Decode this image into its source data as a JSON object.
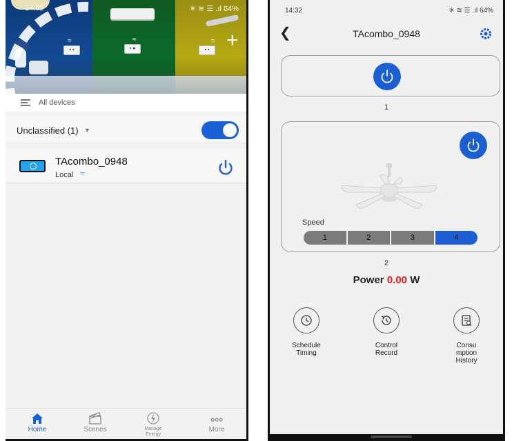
{
  "left_screen": {
    "status_bar": {
      "time": "14:32",
      "icons": "✳ ≋ ☰ .ıl",
      "battery": "64%"
    },
    "filter": {
      "label": "All devices"
    },
    "group": {
      "label": "Unclassified (1)",
      "toggle_on": true
    },
    "device": {
      "name": "TAcombo_0948",
      "connection": "Local"
    },
    "bottom_nav": [
      {
        "label": "Home",
        "icon": "home-icon",
        "active": true
      },
      {
        "label": "Scenes",
        "icon": "scenes-icon",
        "active": false
      },
      {
        "label": "Manage Energy",
        "icon": "energy-icon",
        "active": false
      },
      {
        "label": "More",
        "icon": "more-icon",
        "active": false
      }
    ]
  },
  "right_screen": {
    "status_bar": {
      "time": "14:32",
      "icons": "✳ ≋ ☰ .ıl",
      "battery": "64%"
    },
    "header": {
      "title": "TAcombo_0948"
    },
    "switch_1": {
      "label": "1"
    },
    "switch_2": {
      "label": "2",
      "speed_label": "Speed",
      "speeds": [
        "1",
        "2",
        "3",
        "4"
      ],
      "active_speed": "4"
    },
    "power": {
      "label": "Power",
      "value": "0.00",
      "unit": "W"
    },
    "actions": [
      {
        "label": "Schedule Timing",
        "icon": "clock-icon"
      },
      {
        "label": "Control Record",
        "icon": "history-icon"
      },
      {
        "label": "Consu mption History",
        "icon": "report-icon"
      }
    ]
  },
  "colors": {
    "accent": "#1c5fd4",
    "power_value": "#e01c1c",
    "speed_inactive": "#7b7b7b"
  }
}
